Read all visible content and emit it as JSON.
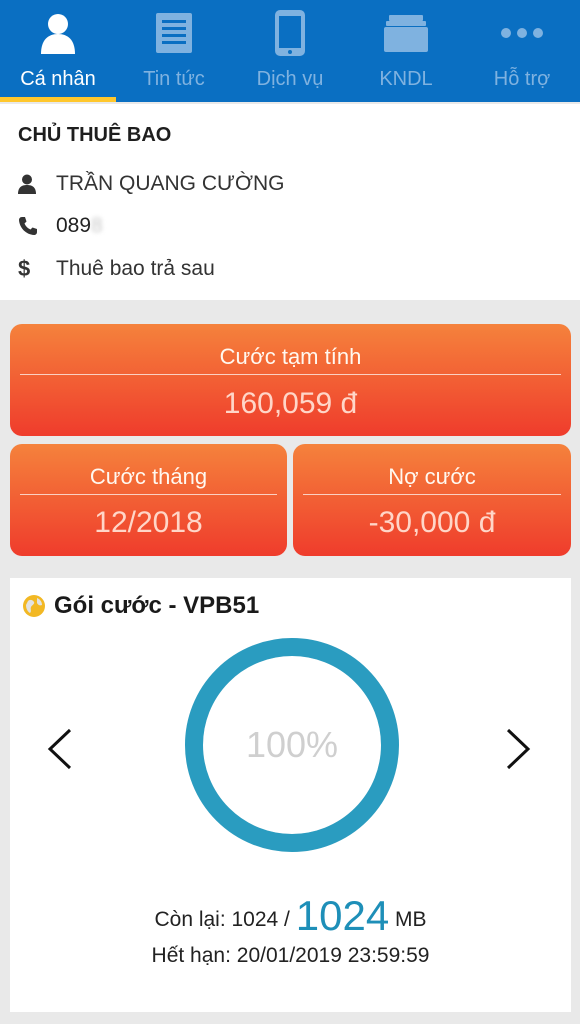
{
  "nav": {
    "tabs": [
      {
        "label": "Cá nhân",
        "icon": "person-icon",
        "active": true
      },
      {
        "label": "Tin tức",
        "icon": "news-icon",
        "active": false
      },
      {
        "label": "Dịch vụ",
        "icon": "phone-icon",
        "active": false
      },
      {
        "label": "KNDL",
        "icon": "folder-icon",
        "active": false
      },
      {
        "label": "Hỗ trợ",
        "icon": "more-dots-icon",
        "active": false
      }
    ]
  },
  "subscriber": {
    "heading": "CHỦ THUÊ BAO",
    "name": "TRẦN QUANG CƯỜNG",
    "phone_visible": "089",
    "phone_blurred": "8",
    "type": "Thuê bao trả sau"
  },
  "billing": {
    "temp_charge_label": "Cước tạm tính",
    "temp_charge_value": "160,059 đ",
    "month_label": "Cước tháng",
    "month_value": "12/2018",
    "debt_label": "Nợ cước",
    "debt_value": "-30,000 đ"
  },
  "package": {
    "title": "Gói cước - VPB51",
    "percent": "100%",
    "percent_value": 100,
    "remain_label": "Còn lại: 1024 /",
    "remain_total": "1024",
    "remain_unit": "MB",
    "expire": "Hết hạn: 20/01/2019 23:59:59"
  },
  "colors": {
    "nav_bg": "#0a6fc2",
    "nav_active_underline": "#ffc72c",
    "card_orange_top": "#f5823c",
    "card_orange_bottom": "#ef3c2c",
    "ring": "#2a9cc0"
  }
}
